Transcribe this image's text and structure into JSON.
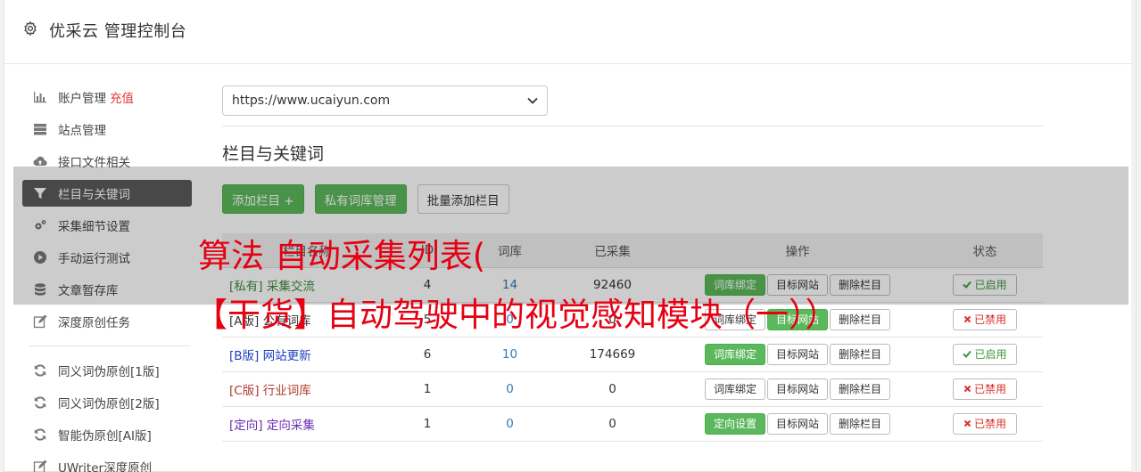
{
  "header": {
    "title": "优采云 管理控制台"
  },
  "sidebar": {
    "items": [
      {
        "label": "账户管理",
        "extra": "充值",
        "icon": "bar-chart-icon"
      },
      {
        "label": "站点管理",
        "icon": "server-icon"
      },
      {
        "label": "接口文件相关",
        "icon": "cloud-upload-icon"
      },
      {
        "label": "栏目与关键词",
        "icon": "filter-icon",
        "active": true
      },
      {
        "label": "采集细节设置",
        "icon": "cogs-icon"
      },
      {
        "label": "手动运行测试",
        "icon": "play-circle-icon"
      },
      {
        "label": "文章暂存库",
        "icon": "database-icon"
      },
      {
        "label": "深度原创任务",
        "icon": "edit-icon"
      }
    ],
    "items2": [
      {
        "label": "同义词伪原创[1版]",
        "icon": "refresh-icon"
      },
      {
        "label": "同义词伪原创[2版]",
        "icon": "refresh-icon"
      },
      {
        "label": "智能伪原创[AI版]",
        "icon": "refresh-icon"
      },
      {
        "label": "UWriter深度原创",
        "icon": "edit-icon"
      }
    ]
  },
  "main": {
    "site_select": {
      "value": "https://www.ucaiyun.com"
    },
    "section_title": "栏目与关键词",
    "buttons": {
      "add_column": "添加栏目 +",
      "private_lexicon": "私有词库管理",
      "batch_add": "批量添加栏目"
    },
    "table": {
      "headers": {
        "name": "栏目名称",
        "id": "ID",
        "words": "词库",
        "collected": "已采集",
        "ops": "操作",
        "status": "状态"
      },
      "rows": [
        {
          "tag": "[私有]",
          "name": "采集交流",
          "id": "4",
          "words": "14",
          "collected": "92460",
          "bind": "词库绑定",
          "bind_green": true,
          "target": "目标网站",
          "target_green": false,
          "delete": "删除栏目",
          "status": "已启用",
          "enabled": true
        },
        {
          "tag": "[A版]",
          "name": "公有词库",
          "id": "5",
          "words": "0",
          "collected": "0",
          "bind": "词库绑定",
          "bind_green": false,
          "target": "目标网站",
          "target_green": true,
          "delete": "删除栏目",
          "status": "已禁用",
          "enabled": false
        },
        {
          "tag": "[B版]",
          "name": "网站更新",
          "id": "6",
          "words": "10",
          "collected": "174669",
          "bind": "词库绑定",
          "bind_green": true,
          "target": "目标网站",
          "target_green": false,
          "delete": "删除栏目",
          "status": "已启用",
          "enabled": true
        },
        {
          "tag": "[C版]",
          "name": "行业词库",
          "id": "1",
          "words": "0",
          "collected": "0",
          "bind": "词库绑定",
          "bind_green": false,
          "target": "目标网站",
          "target_green": false,
          "delete": "删除栏目",
          "status": "已禁用",
          "enabled": false
        },
        {
          "tag": "[定向]",
          "name": "定向采集",
          "id": "1",
          "words": "0",
          "collected": "0",
          "bind": "定向设置",
          "bind_green": true,
          "target": "目标网站",
          "target_green": false,
          "delete": "删除栏目",
          "status": "已禁用",
          "enabled": false
        }
      ]
    }
  },
  "overlay": {
    "line1": "算法 自动采集列表(",
    "line2": "【干货】自动驾驶中的视觉感知模块（一））"
  }
}
